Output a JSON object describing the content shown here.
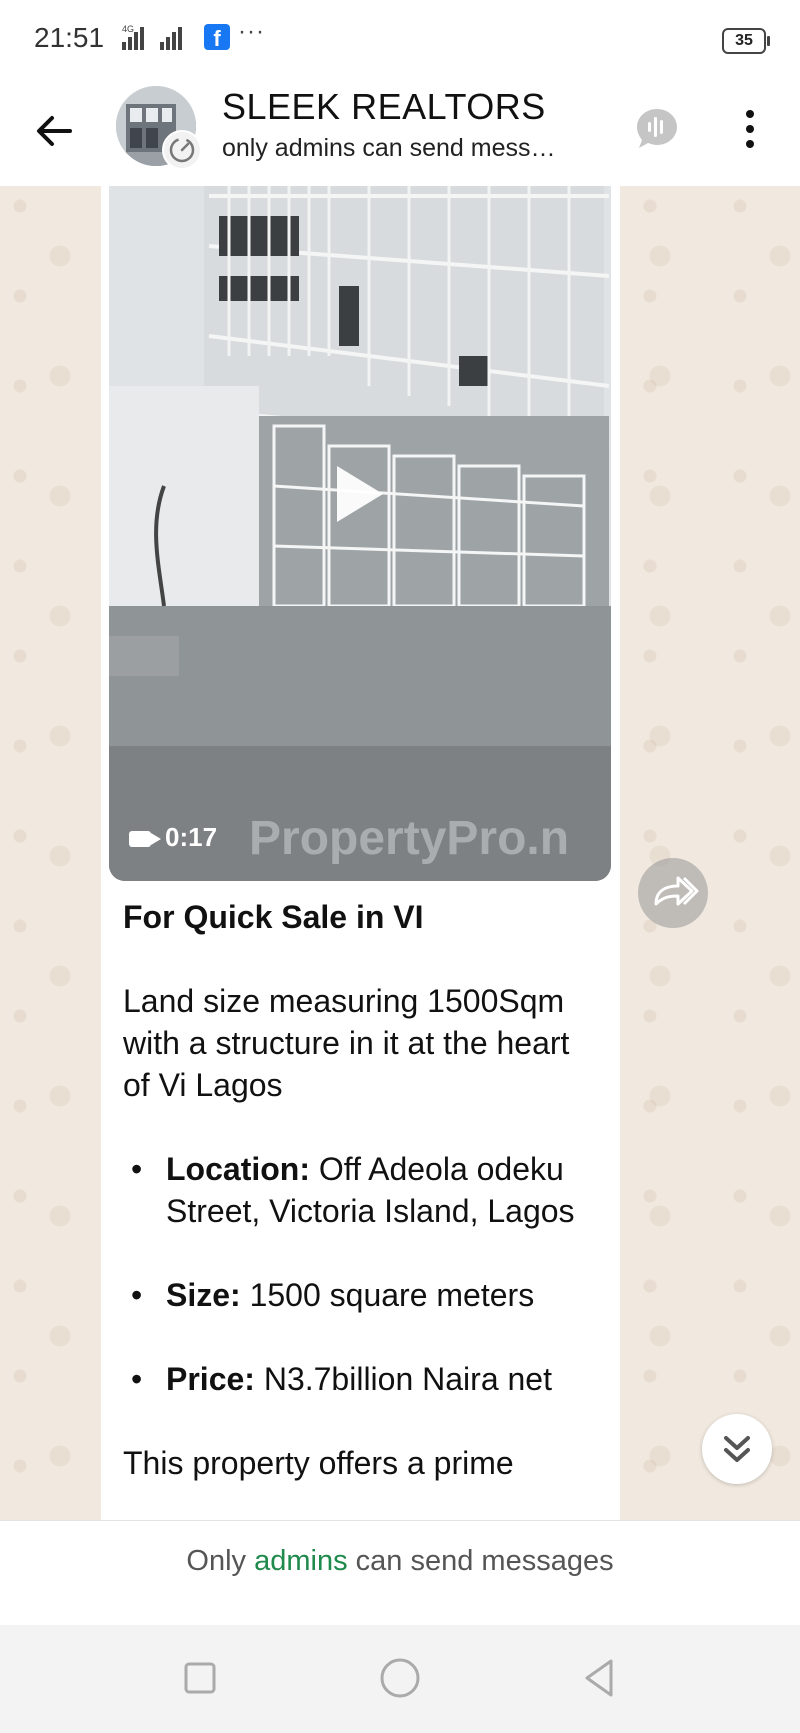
{
  "status_bar": {
    "time": "21:51",
    "network": "4G",
    "app_icon": "f",
    "more": "···",
    "battery": "35"
  },
  "header": {
    "title": "SLEEK REALTORS",
    "subtitle": "only admins can send mess…"
  },
  "video": {
    "duration": "0:17",
    "watermark": "PropertyPro.n"
  },
  "message": {
    "heading": "For Quick Sale in VI",
    "intro": "Land size measuring 1500Sqm with a structure in it at the heart of Vi Lagos",
    "details": [
      {
        "label": "Location:",
        "value": " Off Adeola odeku Street, Victoria Island, Lagos"
      },
      {
        "label": "Size:",
        "value": " 1500 square meters"
      },
      {
        "label": "Price:",
        "value": " N3.7billion Naira net"
      }
    ],
    "continuation": "This property offers a prime"
  },
  "footer": {
    "prefix": "Only ",
    "link": "admins",
    "suffix": " can send messages"
  },
  "colors": {
    "accent_green": "#1f8a4c",
    "chat_bg": "#f1e9df"
  },
  "icons": [
    "back-arrow-icon",
    "group-avatar",
    "voice-chat-icon",
    "kebab-menu-icon",
    "play-icon",
    "video-camera-icon",
    "forward-icon",
    "scroll-down-icon",
    "square-nav-icon",
    "circle-nav-icon",
    "triangle-nav-icon"
  ]
}
